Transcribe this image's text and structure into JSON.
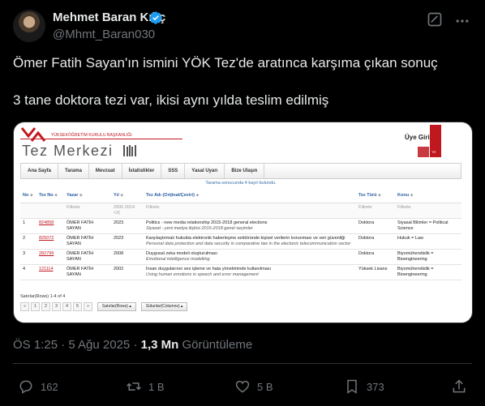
{
  "author": {
    "name": "Mehmet Baran Kılıç",
    "handle": "@Mhmt_Baran030"
  },
  "tweet": {
    "line1": "Ömer Fatih Sayan'ın ismini YÖK Tez'de aratınca karşıma çıkan sonuç",
    "line2": "3 tane doktora tezi var, ikisi aynı yılda teslim edilmiş"
  },
  "media": {
    "caption": "YÜKSEKÖĞRETİM KURULU BAŞKANLIĞI",
    "site_title": "Tez Merkezi",
    "login": "Üye Girişi",
    "nav": [
      "Ana Sayfa",
      "Tarama",
      "Mevzuat",
      "İstatistikler",
      "SSS",
      "Yasal Uyarı",
      "Bize Ulaşın"
    ],
    "scan_info": "Tarama sonucunda 4 kayıt bulundu.",
    "headers": {
      "no": "No",
      "tez_no": "Tez No",
      "yazar": "Yazar",
      "yil": "Yıl",
      "tez_adi": "Tez Adı (Orijinal/Çeviri)",
      "tez_turu": "Tez Türü",
      "konu": "Konu"
    },
    "filters": {
      "yazar": "Filtrele",
      "yil": "2000 2014 <2(",
      "tez_adi": "Filtrele",
      "tez_turu": "Filtrele",
      "konu": "Filtrele"
    },
    "rows": [
      {
        "no": "1",
        "tez_no": "824858",
        "yazar": "ÖMER FATİH SAYAN",
        "yil": "2023",
        "title": "Politics - new media relationship 2015-2018 general elections",
        "subtitle": "Siyaset - yeni medya ilişkisi 2015-2018 genel seçimler",
        "tur": "Doktora",
        "konu": "Siyasal Bilimler = Political Science"
      },
      {
        "no": "2",
        "tez_no": "825072",
        "yazar": "ÖMER FATİH SAYAN",
        "yil": "2023",
        "title": "Karşılaştırmalı hukukta elektronik haberleşme sektöründe kişisel verilerin korunması ve veri güvenliği",
        "subtitle": "Personal data protection and data security in comparative law in the electonic telecommunication sector",
        "tur": "Doktora",
        "konu": "Hukuk = Law"
      },
      {
        "no": "3",
        "tez_no": "282799",
        "yazar": "ÖMER FATİH SAYAN",
        "yil": "2008",
        "title": "Duygusal zeka modeli oluşturulması",
        "subtitle": "Emotional intelligence modelling",
        "tur": "Doktora",
        "konu": "Biyomühendislik = Bioengineering"
      },
      {
        "no": "4",
        "tez_no": "121114",
        "yazar": "ÖMER FATİH SAYAN",
        "yil": "2002",
        "title": "İnsan duygularının ses işleme ve hata yönetiminde kullanılması",
        "subtitle": "Using human emotions in speech and error management",
        "tur": "Yüksek Lisans",
        "konu": "Biyomühendislik = Bioengineering"
      }
    ],
    "rows_info": "Satırlar(Rows) 1-4 of 4",
    "pager": [
      "«",
      "1",
      "2",
      "3",
      "4",
      "5",
      "»"
    ],
    "rows_button": "Satırlar(Rows) ▴",
    "columns_button": "Sütunlar(Columns) ▴"
  },
  "meta": {
    "time": "ÖS 1:25 · 5 Ağu 2025 · ",
    "views": "1,3 Mn",
    "views_label": " Görüntüleme"
  },
  "actions": {
    "replies": "162",
    "reposts": "1 B",
    "likes": "5 B",
    "bookmarks": "373"
  },
  "colors": {
    "accent": "#1d9bf0",
    "yok_red": "#c0181f"
  }
}
